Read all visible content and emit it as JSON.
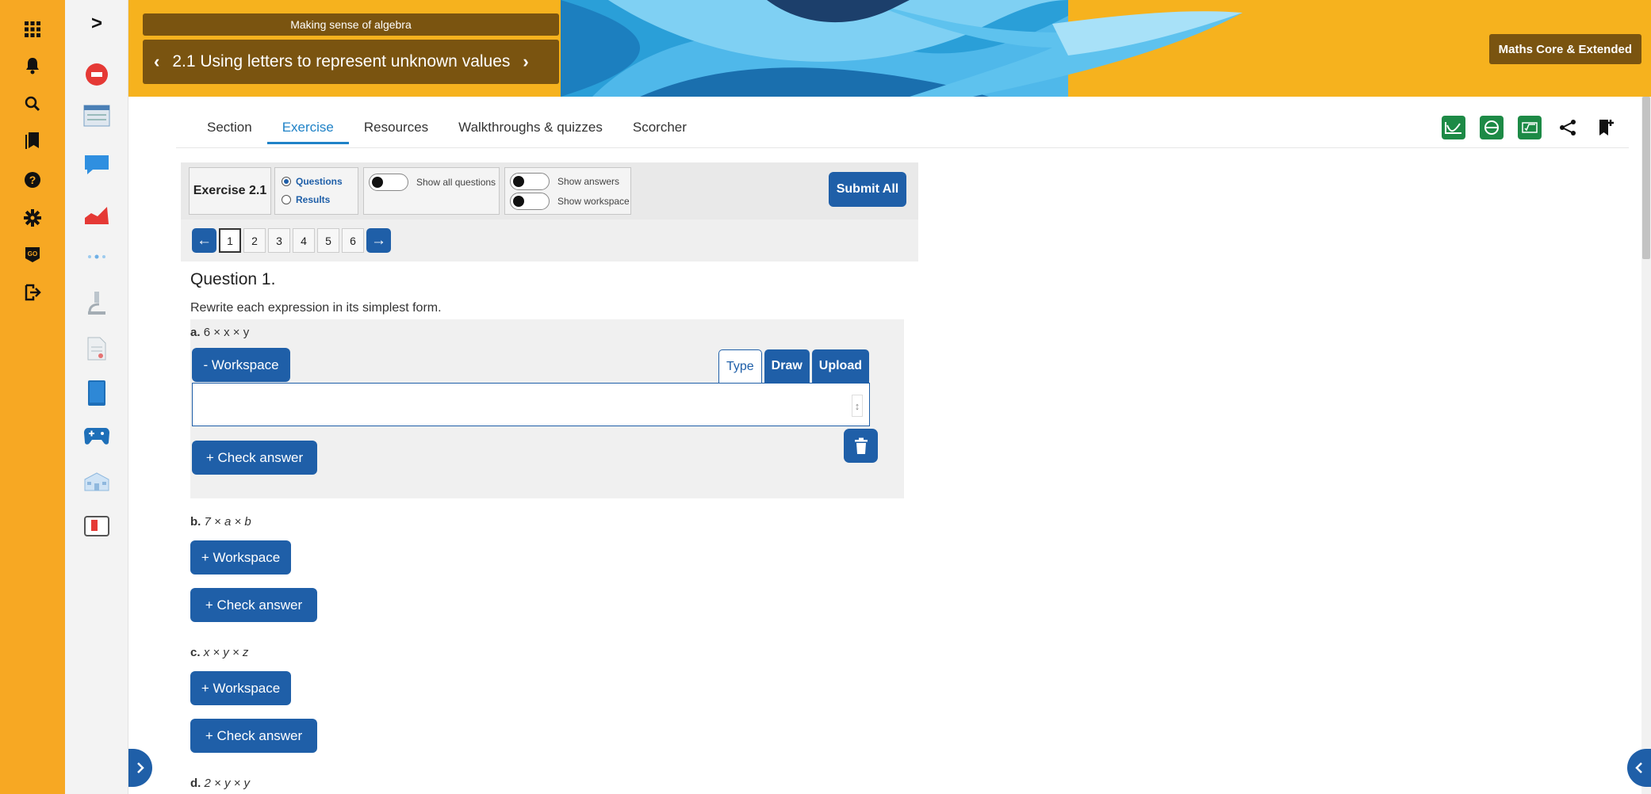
{
  "rail": {
    "icons": [
      "apps-grid-icon",
      "bell-icon",
      "search-icon",
      "bookmarks-icon",
      "help-icon",
      "settings-gear-icon",
      "go-badge-icon",
      "logout-icon"
    ],
    "go_label": "GO"
  },
  "sidebar": {
    "expand_label": ">",
    "icons": [
      "stop-sign-icon",
      "browser-window-icon",
      "chat-bubble-icon",
      "chart-icon",
      "dots-icon",
      "microscope-icon",
      "document-icon",
      "book-icon",
      "gamepad-icon",
      "school-icon",
      "flag-card-icon"
    ]
  },
  "header": {
    "breadcrumb_top": "Making sense of algebra",
    "breadcrumb_title": "2.1 Using letters to represent unknown values",
    "prev": "‹",
    "next": "›",
    "course_badge": "Maths Core & Extended"
  },
  "tabs": [
    {
      "label": "Section"
    },
    {
      "label": "Exercise",
      "active": true
    },
    {
      "label": "Resources"
    },
    {
      "label": "Walkthroughs & quizzes"
    },
    {
      "label": "Scorcher"
    }
  ],
  "tools": [
    "graph-tool-icon",
    "globe-tool-icon",
    "calculator-tool-icon",
    "share-icon",
    "bookmark-add-icon"
  ],
  "exercise": {
    "title": "Exercise 2.1",
    "mode_questions": "Questions",
    "mode_results": "Results",
    "show_all_questions": "Show all questions",
    "show_answers": "Show answers",
    "show_workspace": "Show workspace",
    "submit_all": "Submit All",
    "pages": [
      "1",
      "2",
      "3",
      "4",
      "5",
      "6"
    ],
    "prev_arrow": "←",
    "next_arrow": "→"
  },
  "question": {
    "title": "Question 1.",
    "instruction": "Rewrite each expression in its simplest form.",
    "parts": [
      {
        "letter": "a.",
        "expr": "6 × x × y",
        "workspace_label": "- Workspace",
        "check_label": "+ Check answer"
      },
      {
        "letter": "b.",
        "expr": "7 × a × b",
        "workspace_label": "+ Workspace",
        "check_label": "+ Check answer"
      },
      {
        "letter": "c.",
        "expr": "x × y × z",
        "workspace_label": "+ Workspace",
        "check_label": "+ Check answer"
      },
      {
        "letter": "d.",
        "expr": "2 × y × y"
      }
    ],
    "workspace_tabs": [
      "Type",
      "Draw",
      "Upload"
    ],
    "resize_glyph": "↕"
  },
  "colors": {
    "rail": "#f7a823",
    "banner": "#f6b21e",
    "crumb": "#7a5410",
    "primary": "#1f5fa8",
    "tab_active": "#1f82c7",
    "tool_green": "#1d8a46"
  }
}
